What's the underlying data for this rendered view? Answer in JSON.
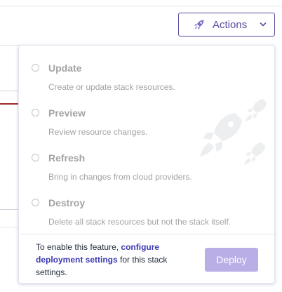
{
  "actions_button": {
    "label": "Actions",
    "icon": "rocket-icon",
    "accent": "#5b4a9e"
  },
  "menu": {
    "options": [
      {
        "title": "Update",
        "description": "Create or update stack resources."
      },
      {
        "title": "Preview",
        "description": "Review resource changes."
      },
      {
        "title": "Refresh",
        "description": "Bring in changes from cloud providers."
      },
      {
        "title": "Destroy",
        "description": "Delete all stack resources but not the stack itself."
      }
    ],
    "footer": {
      "prefix": "To enable this feature, ",
      "link": "configure deployment settings",
      "suffix": " for this stack settings."
    },
    "deploy_label": "Deploy"
  }
}
